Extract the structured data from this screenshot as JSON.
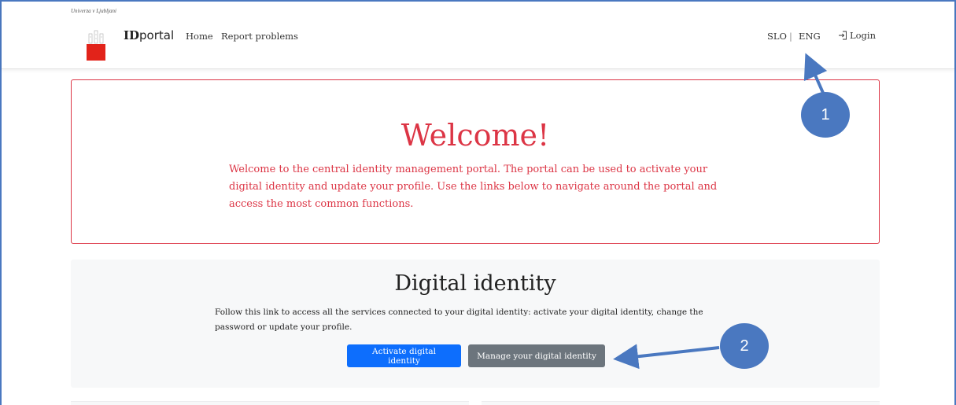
{
  "header": {
    "university": "Univerza v Ljubljani",
    "brand_bold": "ID",
    "brand_rest": "portal",
    "nav": [
      {
        "label": "Home"
      },
      {
        "label": "Report problems"
      }
    ],
    "lang_slo": "SLO",
    "lang_sep": "|",
    "lang_eng": "ENG",
    "login": "Login"
  },
  "welcome": {
    "title": "Welcome!",
    "text": "Welcome to the central identity management portal. The portal can be used to activate your digital identity and update your profile. Use the links below to navigate around the portal and access the most common functions."
  },
  "digital_identity": {
    "title": "Digital identity",
    "text": "Follow this link to access all the services connected to your digital identity: activate your digital identity, change the password or update your profile.",
    "activate_label": "Activate digital identity",
    "manage_label": "Manage your digital identity"
  },
  "annotations": {
    "marker_1": "1",
    "marker_2": "2"
  },
  "colors": {
    "accent_red": "#dc3545",
    "primary_blue": "#0d6efd",
    "secondary_gray": "#6c757d",
    "annotation_blue": "#4a78c0"
  }
}
